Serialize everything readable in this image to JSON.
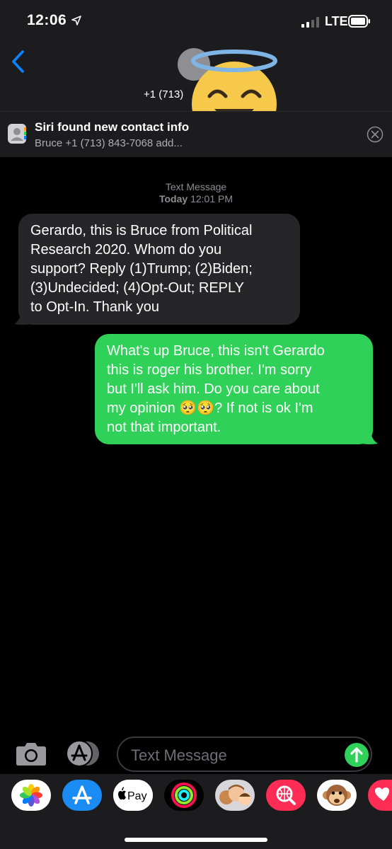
{
  "status": {
    "time": "12:06",
    "network": "LTE"
  },
  "header": {
    "contact_number": "+1 (713)"
  },
  "siri_banner": {
    "title": "Siri found new contact info",
    "subtitle": "Bruce +1 (713) 843-7068  add..."
  },
  "conversation": {
    "service_label": "Text Message",
    "day": "Today",
    "time": "12:01 PM",
    "messages": [
      {
        "direction": "incoming",
        "text": "Gerardo, this is Bruce from Political\nResearch 2020. Whom do you\nsupport? Reply (1)Trump; (2)Biden;\n(3)Undecided; (4)Opt-Out; REPLY\nto Opt-In. Thank you"
      },
      {
        "direction": "outgoing",
        "text": "What's up Bruce, this isn't Gerardo\nthis is roger his brother. I'm sorry\nbut I'll ask him. Do you care about\nmy opinion 🥺🥺? If not is ok I'm\nnot that important."
      }
    ]
  },
  "composer": {
    "placeholder": "Text Message"
  },
  "app_drawer": {
    "apps": [
      {
        "name": "Photos",
        "icon": "photos-icon"
      },
      {
        "name": "App Store",
        "icon": "app-store-icon"
      },
      {
        "name": "Apple Pay",
        "icon": "apple-pay-icon",
        "label": "Pay"
      },
      {
        "name": "Activity",
        "icon": "activity-rings-icon"
      },
      {
        "name": "Memoji Stickers",
        "icon": "memoji-icon"
      },
      {
        "name": "Images",
        "icon": "images-search-icon"
      },
      {
        "name": "Animoji",
        "icon": "monkey-animoji-icon"
      },
      {
        "name": "Digital Touch",
        "icon": "digital-touch-icon"
      }
    ]
  },
  "colors": {
    "outgoing_bubble": "#30d158",
    "incoming_bubble": "#262628",
    "accent": "#0a84ff",
    "header_bg": "#1c1c1e"
  }
}
